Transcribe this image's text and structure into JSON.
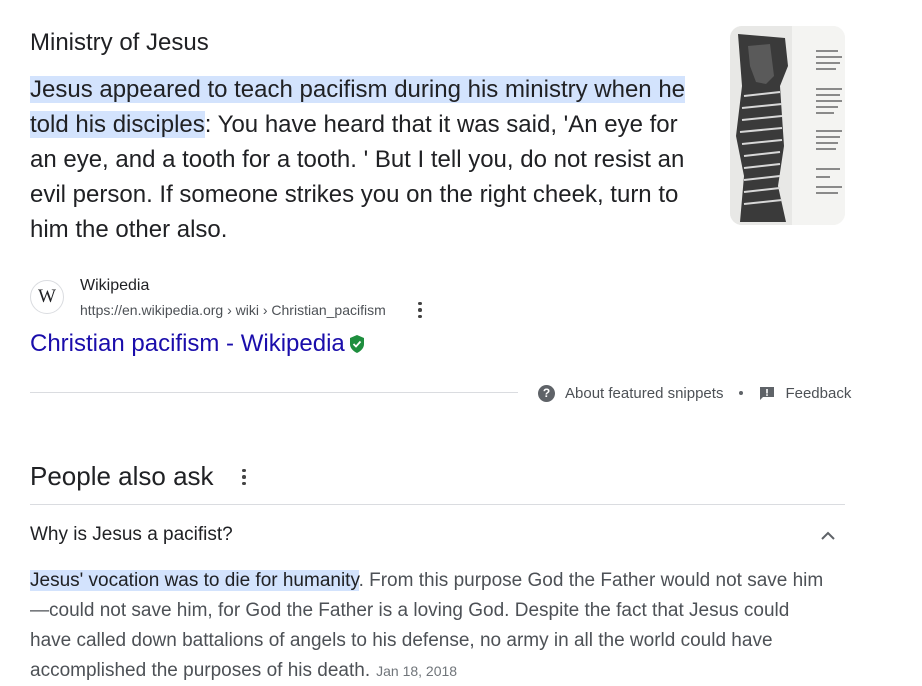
{
  "featured_snippet": {
    "title": "Ministry of Jesus",
    "highlight": "Jesus appeared to teach pacifism during his ministry when he told his disciples",
    "rest": ": You have heard that it was said, 'An eye for an eye, and a tooth for a tooth. ' But I tell you, do not resist an evil person. If someone strikes you on the right cheek, turn to him the other also.",
    "source": {
      "icon_letter": "W",
      "name": "Wikipedia",
      "url": "https://en.wikipedia.org › wiki › Christian_pacifism",
      "link_text": "Christian pacifism - Wikipedia"
    },
    "about_label": "About featured snippets",
    "feedback_label": "Feedback"
  },
  "people_also_ask": {
    "title": "People also ask",
    "question": "Why is Jesus a pacifist?",
    "answer_highlight": "Jesus' vocation was to die for humanity",
    "answer_rest": ". From this purpose God the Father would not save him—could not save him, for God the Father is a loving God. Despite the fact that Jesus could have called down battalions of angels to his defense, no army in all the world could have accomplished the purposes of his death.",
    "answer_date": "Jan 18, 2018"
  },
  "colors": {
    "link": "#1a0dab",
    "highlight": "#d3e3fd",
    "verified": "#1e8e3e"
  },
  "icons": [
    "wikipedia-icon",
    "kebab-menu-icon",
    "verified-badge-icon",
    "help-icon",
    "feedback-icon",
    "chevron-up-icon"
  ]
}
